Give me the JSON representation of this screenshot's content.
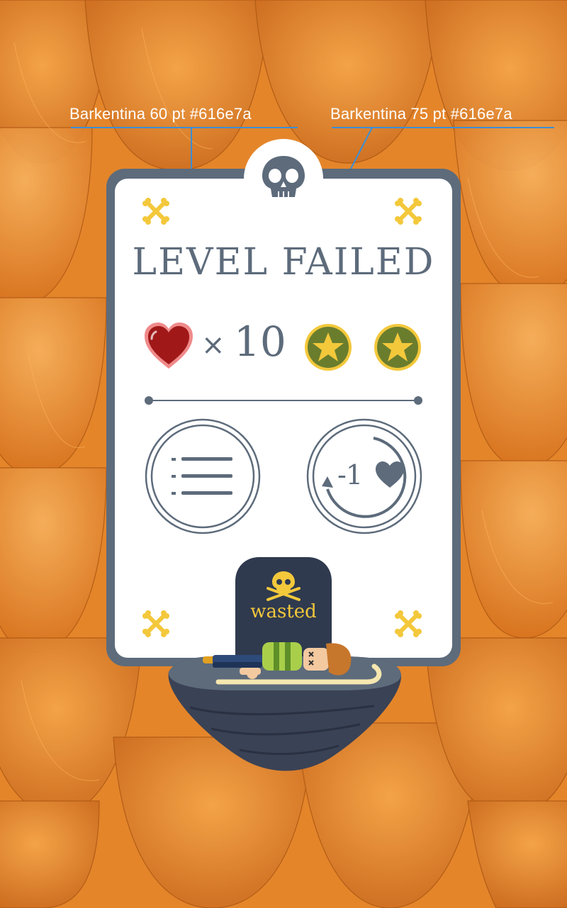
{
  "annotations": {
    "title_font_note": "Barkentina 60 pt #616e7a",
    "count_font_note": "Barkentina 75 pt #616e7a"
  },
  "panel": {
    "title": "LEVEL FAILED",
    "multiplier_symbol": "×",
    "lives_count": "10",
    "stars_earned": 2,
    "retry_cost_label": "-1",
    "tombstone_text": "wasted"
  },
  "icons": {
    "header": "skull-icon",
    "corners": "crossbones-icon",
    "lives": "heart-icon",
    "stars": "star-medal-icon",
    "menu": "list-icon",
    "retry": "retry-arrow-icon"
  },
  "colors": {
    "text": "#5d6b7b",
    "annotation_line": "#3a8fd6",
    "bone": "#f3c83b",
    "heart": "#a01818",
    "medal": "#6a7d2d",
    "star": "#f3c83b",
    "background": "#e07f24"
  }
}
